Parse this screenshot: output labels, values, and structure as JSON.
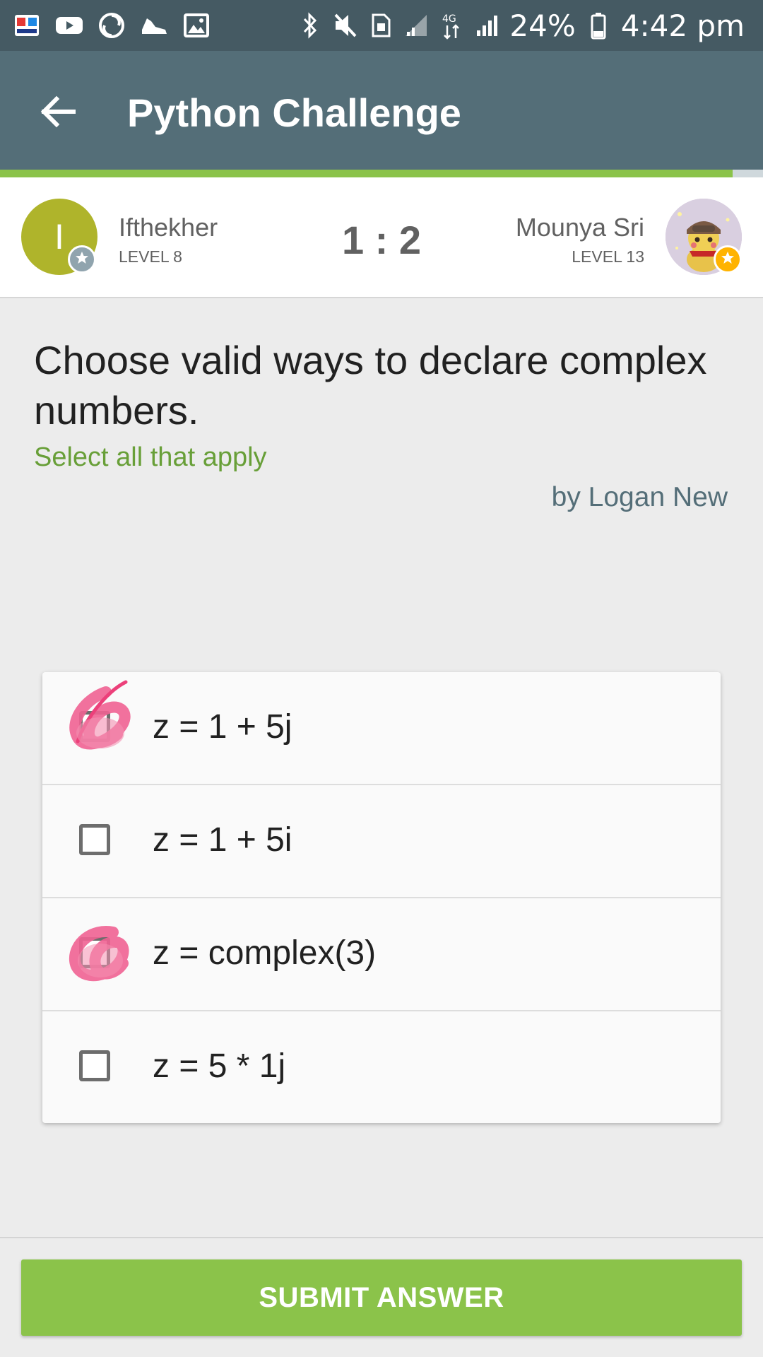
{
  "status_bar": {
    "battery": "24%",
    "time": "4:42 pm",
    "network": "4G",
    "left_icons": [
      "bangla-app-icon",
      "youtube-icon",
      "swirl-app-icon",
      "shoe-icon",
      "gallery-icon"
    ],
    "right_icons": [
      "bluetooth-icon",
      "mute-icon",
      "sim-icon",
      "signal-icon",
      "data-arrows-icon",
      "signal-icon",
      "battery-icon"
    ]
  },
  "app_bar": {
    "title": "Python Challenge",
    "back_icon": "arrow-left-icon",
    "progress_fraction": 0.96
  },
  "players": {
    "left": {
      "initial": "I",
      "name": "Ifthekher",
      "level": "LEVEL 8",
      "avatar_color": "#afb42b",
      "badge_color": "#90a4ae"
    },
    "score": "1 : 2",
    "right": {
      "name": "Mounya Sri",
      "level": "LEVEL 13",
      "badge_color": "#ffb300"
    }
  },
  "question": {
    "text": "Choose valid ways to declare complex numbers.",
    "hint": "Select all that apply",
    "author": "by Logan New"
  },
  "answers": [
    {
      "text": "z = 1 + 5j",
      "checked": true
    },
    {
      "text": "z = 1 + 5i",
      "checked": false
    },
    {
      "text": "z = complex(3)",
      "checked": true
    },
    {
      "text": "z = 5 * 1j",
      "checked": false
    }
  ],
  "submit": {
    "label": "SUBMIT ANSWER"
  },
  "colors": {
    "app_bar": "#546e78",
    "status_bar": "#455a63",
    "accent_green": "#8bc34a",
    "hint_green": "#689f38",
    "scribble_pink": "#f06292"
  }
}
